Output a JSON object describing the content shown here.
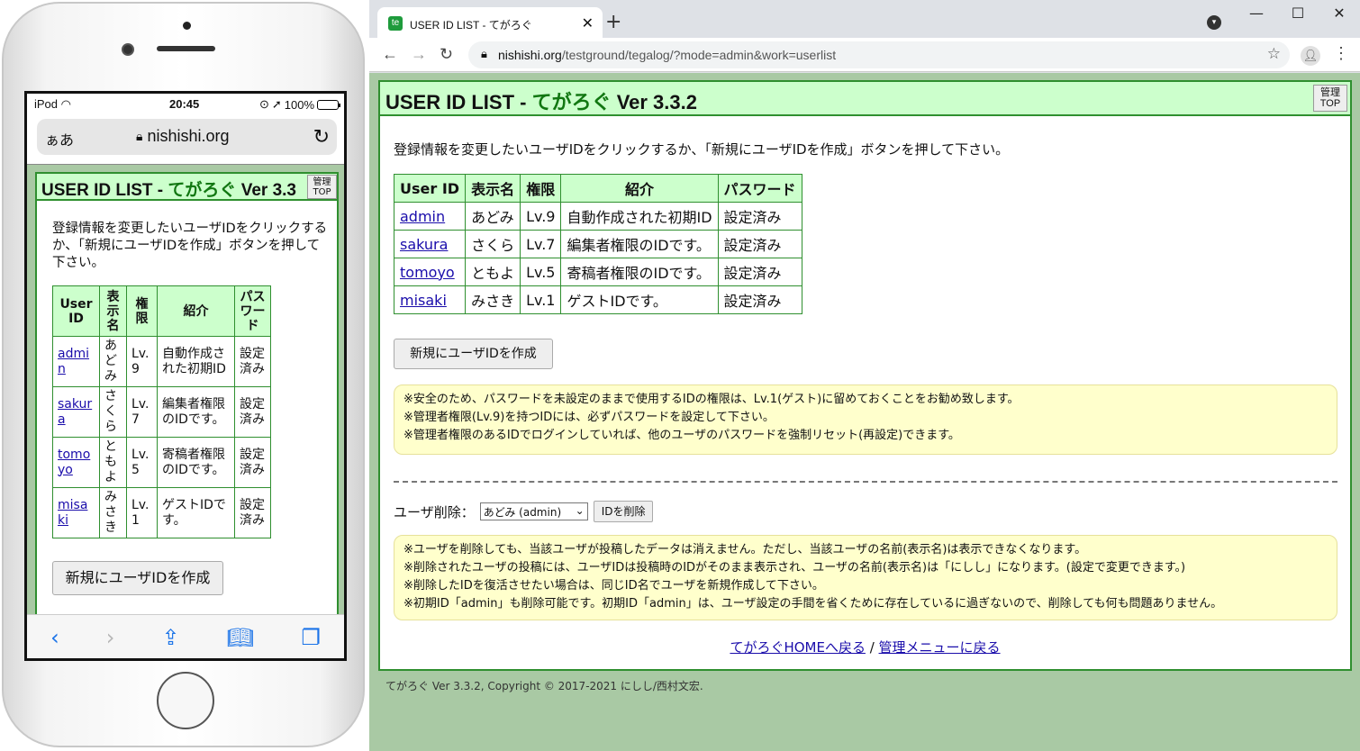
{
  "phone": {
    "status": {
      "carrier": "iPod",
      "time": "20:45",
      "battery": "100%",
      "battery_level": 1.0
    },
    "address": {
      "aa": "ぁあ",
      "host": "nishishi.org"
    }
  },
  "app": {
    "title_prefix": "USER ID LIST - ",
    "title_jp": "てがろぐ",
    "title_ver": " Ver 3.3.2",
    "mobile_title_ver": " Ver 3.3",
    "mgmt_top": {
      "line1": "管理",
      "line2": "TOP"
    },
    "description": "登録情報を変更したいユーザIDをクリックするか、「新規にユーザIDを作成」ボタンを押して下さい。",
    "table": {
      "headers": [
        "User ID",
        "表示名",
        "権限",
        "紹介",
        "パスワード"
      ],
      "mobile_headers": [
        "User<br>ID",
        "表<br>示<br>名",
        "権<br>限",
        "紹介",
        "パス<br>ワー<br>ド"
      ],
      "rows": [
        {
          "id": "admin",
          "name": "あどみ",
          "level": "Lv.9",
          "intro": "自動作成された初期ID",
          "password": "設定済み"
        },
        {
          "id": "sakura",
          "name": "さくら",
          "level": "Lv.7",
          "intro": "編集者権限のIDです。",
          "password": "設定済み"
        },
        {
          "id": "tomoyo",
          "name": "ともよ",
          "level": "Lv.5",
          "intro": "寄稿者権限のIDです。",
          "password": "設定済み"
        },
        {
          "id": "misaki",
          "name": "みさき",
          "level": "Lv.1",
          "intro": "ゲストIDです。",
          "password": "設定済み"
        }
      ]
    },
    "create_button": "新規にユーザIDを作成",
    "notes1": [
      "※安全のため、パスワードを未設定のままで使用するIDの権限は、Lv.1(ゲスト)に留めておくことをお勧め致します。",
      "※管理者権限(Lv.9)を持つIDには、必ずパスワードを設定して下さい。",
      "※管理者権限のあるIDでログインしていれば、他のユーザのパスワードを強制リセット(再設定)できます。"
    ],
    "delete": {
      "label": "ユーザ削除：",
      "selected": "あどみ (admin)",
      "button": "IDを削除"
    },
    "notes2": [
      "※ユーザを削除しても、当該ユーザが投稿したデータは消えません。ただし、当該ユーザの名前(表示名)は表示できなくなります。",
      "※削除されたユーザの投稿には、ユーザIDは投稿時のIDがそのまま表示され、ユーザの名前(表示名)は「にしし」になります。(設定で変更できます。)",
      "※削除したIDを復活させたい場合は、同じID名でユーザを新規作成して下さい。",
      "※初期ID「admin」も削除可能です。初期ID「admin」は、ユーザ設定の手間を省くために存在しているに過ぎないので、削除しても何も問題ありません。"
    ],
    "links": {
      "home": "てがろぐHOMEへ戻る",
      "sep": " / ",
      "menu": "管理メニューに戻る"
    },
    "footer": "てがろぐ Ver 3.3.2, Copyright © 2017-2021 にしし/西村文宏."
  },
  "browser": {
    "tab_title": "USER ID LIST - てがろぐ",
    "url_host": "nishishi.org",
    "url_path": "/testground/tegalog/?mode=admin&work=userlist"
  }
}
